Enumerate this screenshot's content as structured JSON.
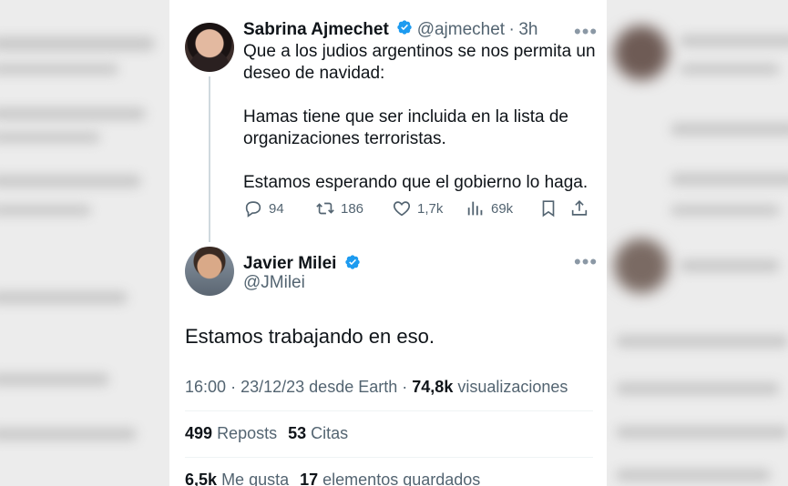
{
  "reply_to": {
    "name": "Sabrina Ajmechet",
    "handle": "@ajmechet",
    "separator": "·",
    "time": "3h",
    "paragraphs": [
      "Que a los judios argentinos se nos permita un deseo de navidad:",
      "Hamas tiene que ser incluida en la lista de organizaciones terroristas.",
      "Estamos esperando que el gobierno lo haga."
    ],
    "replies": "94",
    "reposts": "186",
    "likes": "1,7k",
    "views": "69k"
  },
  "tweet": {
    "name": "Javier Milei",
    "handle": "@JMilei",
    "text": "Estamos trabajando en eso.",
    "time": "16:00",
    "date": "23/12/23",
    "source": "desde Earth",
    "views_count": "74,8k",
    "views_label": "visualizaciones",
    "meta_sep": "·",
    "reposts_count": "499",
    "reposts_label": "Reposts",
    "quotes_count": "53",
    "quotes_label": "Citas",
    "likes_count": "6,5k",
    "likes_label": "Me gusta",
    "bookmarks_count": "17",
    "bookmarks_label": "elementos guardados"
  },
  "icons": {
    "verified": "verified-badge-icon",
    "more": "more-options-icon",
    "reply": "reply-icon",
    "repost": "repost-icon",
    "like": "like-icon",
    "views": "views-icon",
    "bookmark": "bookmark-icon",
    "share": "share-icon"
  },
  "colors": {
    "accent": "#1d9bf0",
    "text": "#0f1419",
    "muted": "#536471"
  }
}
